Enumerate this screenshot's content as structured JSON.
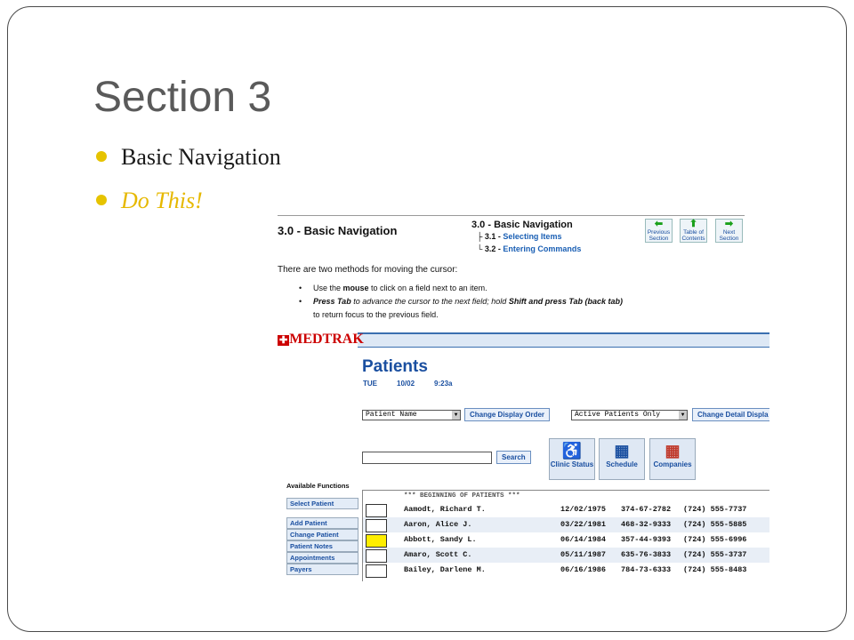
{
  "slide": {
    "title": "Section 3",
    "bullets": [
      "Basic Navigation",
      "Do This!"
    ]
  },
  "doc": {
    "heading": "3.0 - Basic Navigation",
    "toc_title": "3.0 - Basic Navigation",
    "toc_items": [
      {
        "num": "3.1 -",
        "label": "Selecting Items"
      },
      {
        "num": "3.2 -",
        "label": "Entering Commands"
      }
    ],
    "nav": {
      "prev": "Previous Section",
      "toc": "Table of Contents",
      "next": "Next Section"
    },
    "intro": "There are two methods for moving the cursor:",
    "items": [
      {
        "a": "Use the ",
        "b": "mouse",
        "c": " to click on a field next to an item."
      },
      {
        "a": "Press Tab",
        "b": " to advance the cursor to the next field; hold ",
        "c": "Shift and press Tab (back tab)"
      },
      {
        "a": "to return focus to the previous field.",
        "b": "",
        "c": ""
      }
    ]
  },
  "app": {
    "logo": "MEDTRAK",
    "title": "Patients",
    "day": "TUE",
    "date": "10/02",
    "time": "9:23a",
    "display_select": "Patient Name",
    "change_display_order": "Change Display Order",
    "detail_select": "Active Patients Only",
    "change_detail_display": "Change Detail Displa",
    "search_button": "Search",
    "tiles": [
      "Clinic Status",
      "Schedule",
      "Companies"
    ],
    "available_functions": "Available Functions",
    "functions": [
      "Select Patient",
      "Add Patient",
      "Change Patient",
      "Patient Notes",
      "Appointments",
      "Payers"
    ],
    "list_header": "*** BEGINNING OF PATIENTS ***",
    "patients": [
      {
        "name": "Aamodt, Richard T.",
        "dob": "12/02/1975",
        "ssn": "374-67-2782",
        "phone": "(724) 555-7737"
      },
      {
        "name": "Aaron, Alice J.",
        "dob": "03/22/1981",
        "ssn": "468-32-9333",
        "phone": "(724) 555-5885"
      },
      {
        "name": "Abbott, Sandy L.",
        "dob": "06/14/1984",
        "ssn": "357-44-9393",
        "phone": "(724) 555-6996"
      },
      {
        "name": "Amaro, Scott C.",
        "dob": "05/11/1987",
        "ssn": "635-76-3833",
        "phone": "(724) 555-3737"
      },
      {
        "name": "Bailey, Darlene M.",
        "dob": "06/16/1986",
        "ssn": "784-73-6333",
        "phone": "(724) 555-8483"
      }
    ]
  }
}
